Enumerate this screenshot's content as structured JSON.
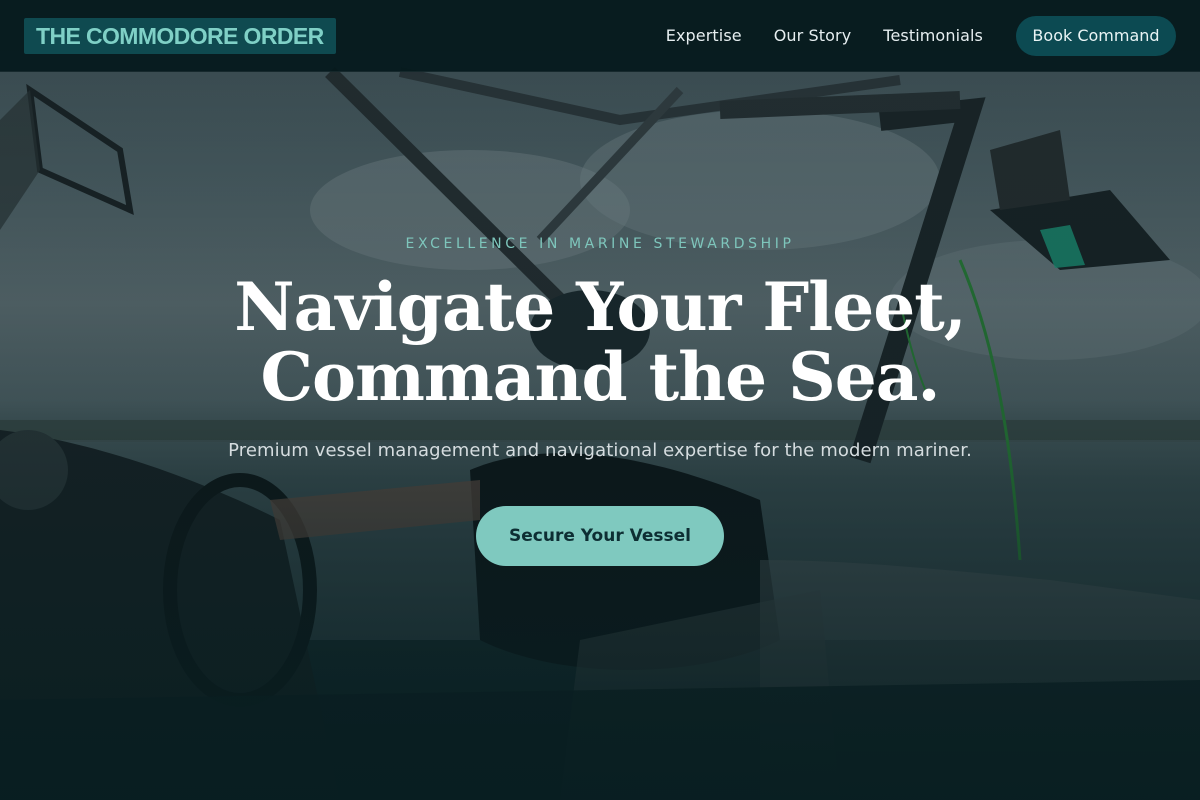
{
  "brand": {
    "name": "THE COMMODORE ORDER"
  },
  "nav": {
    "links": [
      "Expertise",
      "Our Story",
      "Testimonials"
    ],
    "cta_label": "Book Command"
  },
  "hero": {
    "eyebrow": "EXCELLENCE IN MARINE STEWARDSHIP",
    "headline_line1": "Navigate Your Fleet,",
    "headline_line2": "Command the Sea.",
    "subhead": "Premium vessel management and navigational expertise for the modern mariner.",
    "cta_label": "Secure Your Vessel",
    "background_image": "man-driving-speedboat-photo"
  },
  "colors": {
    "nav_bg": "#051a1d",
    "brand_bg": "#0f4a50",
    "brand_text": "#7fd0c6",
    "accent": "#7fc9bf",
    "button_dark": "#0c4a52",
    "eyebrow": "#7ec6bc"
  }
}
